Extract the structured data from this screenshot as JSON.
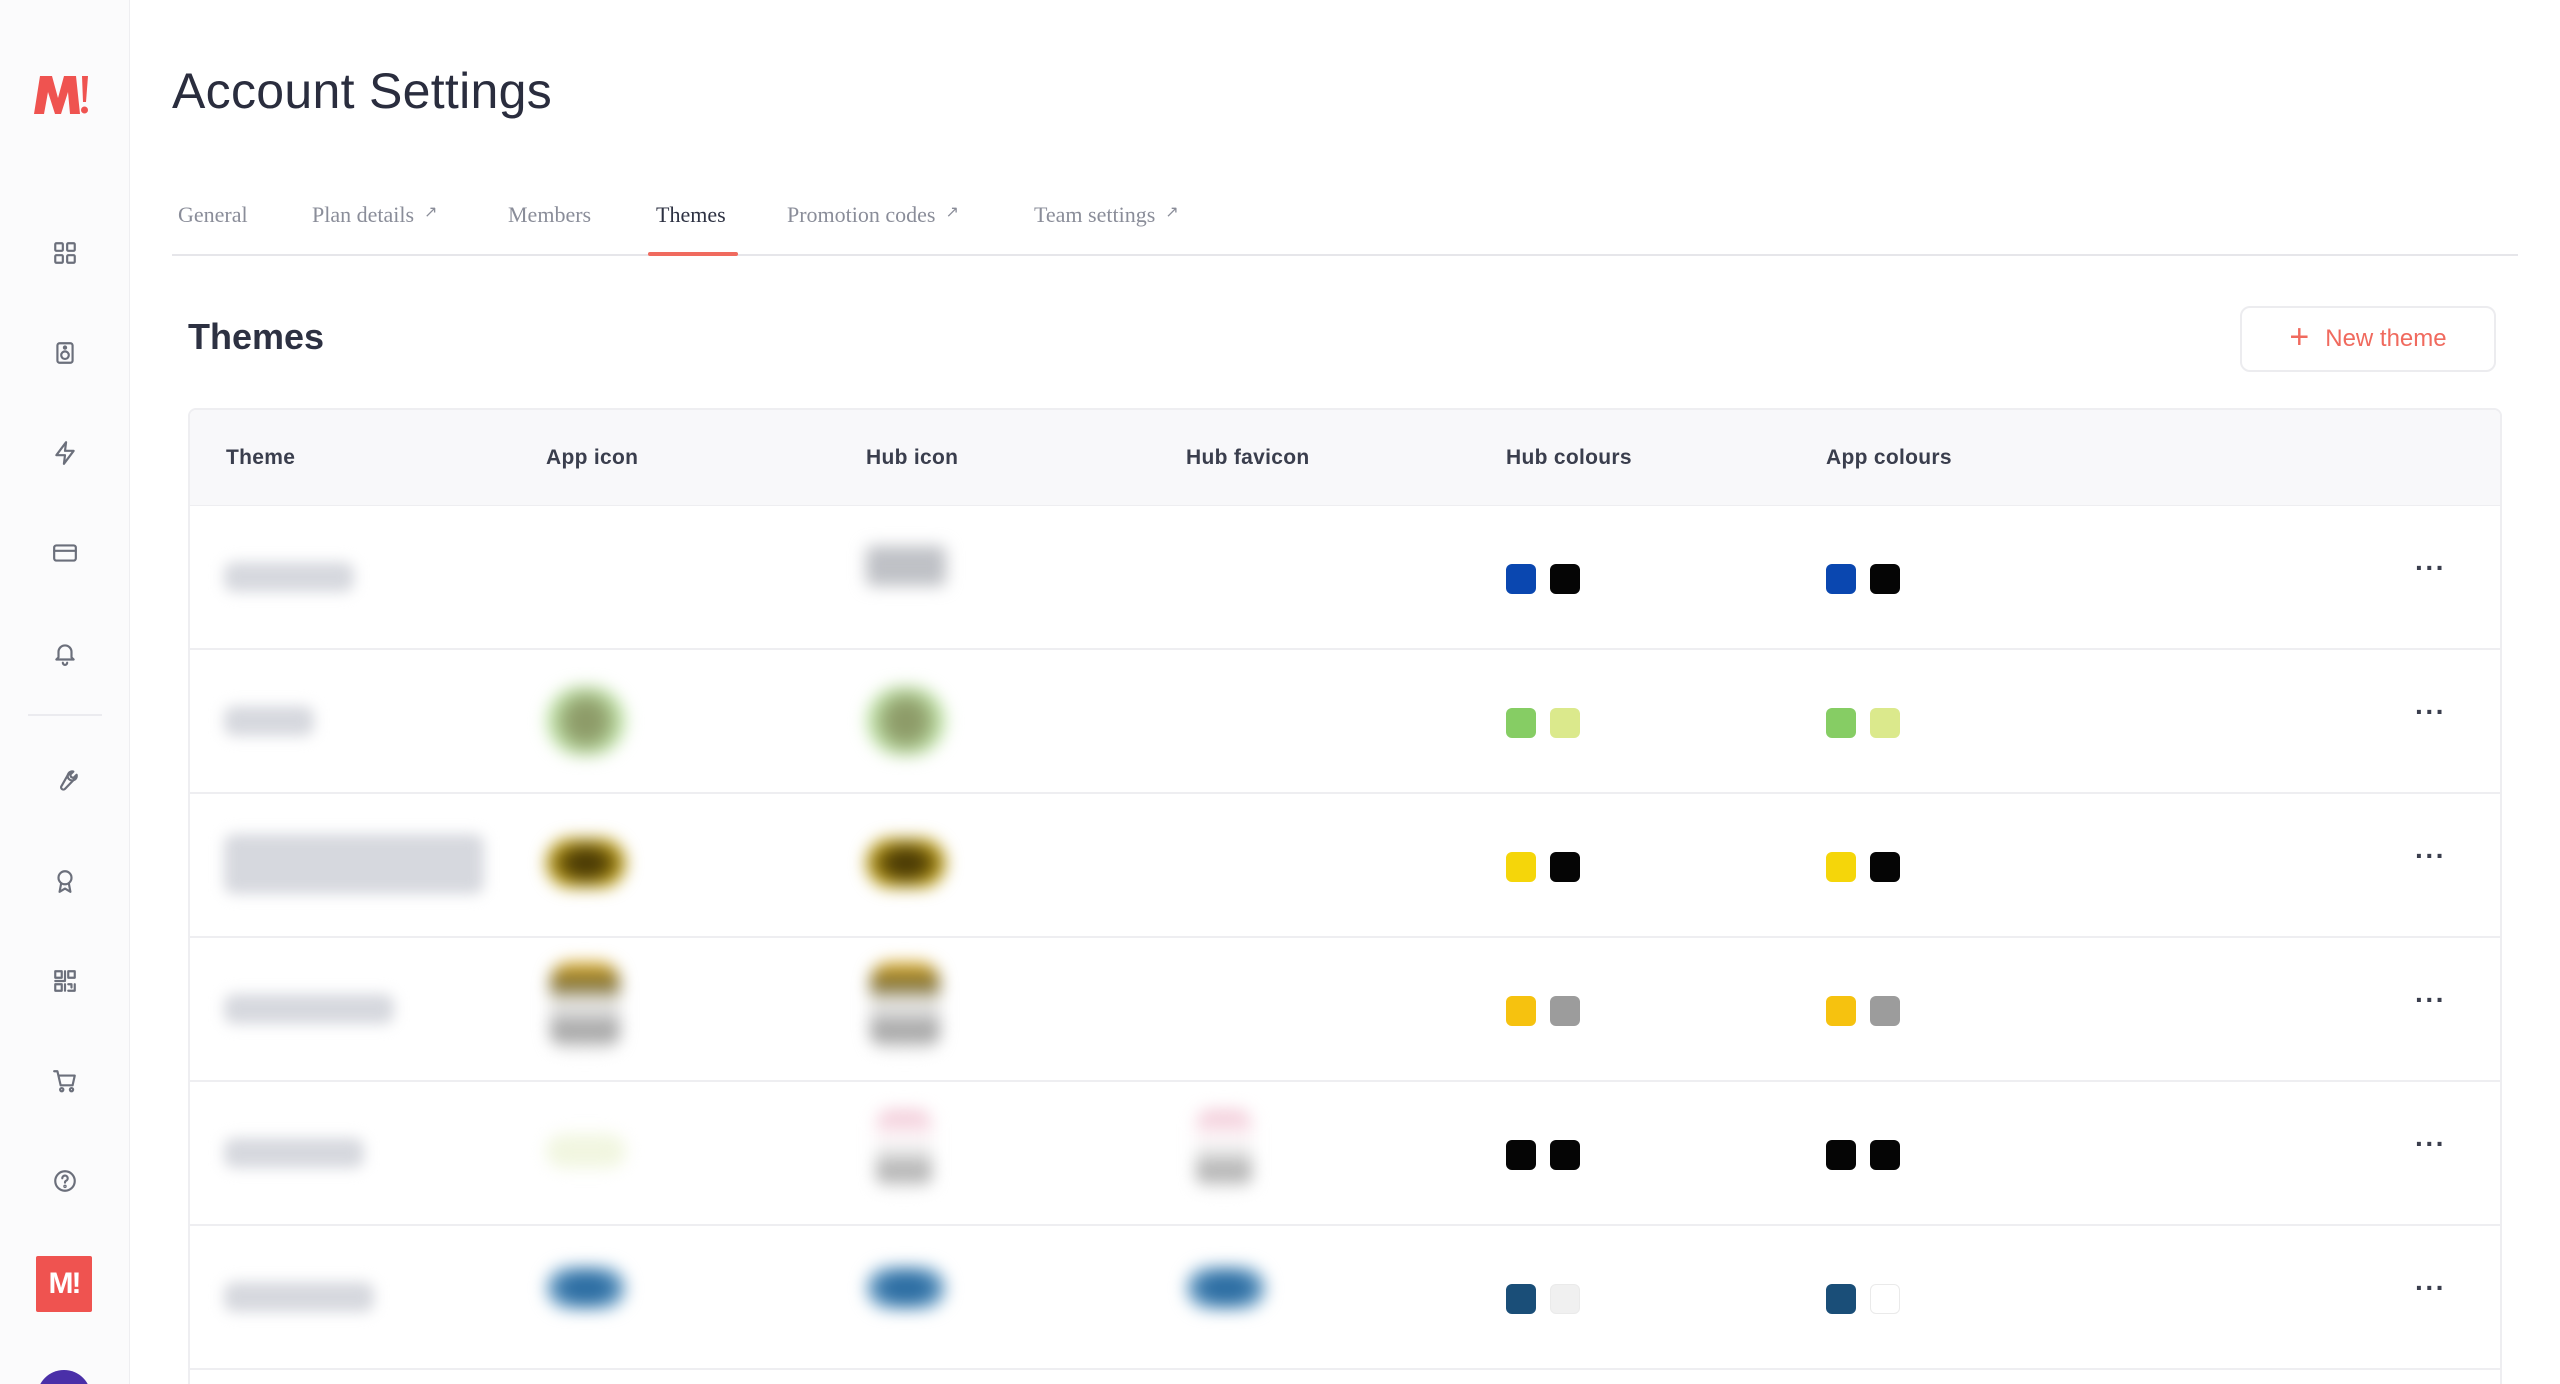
{
  "sidebar": {
    "logo_text": "M!",
    "icons": [
      "grid-icon",
      "speaker-icon",
      "lightning-icon",
      "card-icon",
      "bell-icon",
      "wrench-icon",
      "award-icon",
      "qr-code-icon",
      "cart-icon",
      "help-icon"
    ],
    "brand_badge": "M!"
  },
  "header": {
    "title": "Account Settings"
  },
  "tabs": [
    {
      "label": "General",
      "external": false
    },
    {
      "label": "Plan details",
      "external": true
    },
    {
      "label": "Members",
      "external": false
    },
    {
      "label": "Themes",
      "external": false,
      "active": true
    },
    {
      "label": "Promotion codes",
      "external": true
    },
    {
      "label": "Team settings",
      "external": true
    }
  ],
  "ext_glyph": "↗",
  "section": {
    "title": "Themes",
    "new_button": "New theme"
  },
  "table": {
    "columns": [
      "Theme",
      "App icon",
      "Hub icon",
      "Hub favicon",
      "Hub colours",
      "App colours"
    ],
    "rows": [
      {
        "hub_colours": [
          "#0a47b0",
          "#050505"
        ],
        "app_colours": [
          "#0a47b0",
          "#050505"
        ]
      },
      {
        "hub_colours": [
          "#86cd64",
          "#dbe98c"
        ],
        "app_colours": [
          "#86cd64",
          "#dbe98c"
        ]
      },
      {
        "hub_colours": [
          "#f5d60a",
          "#050505"
        ],
        "app_colours": [
          "#f5d60a",
          "#050505"
        ]
      },
      {
        "hub_colours": [
          "#f6c20f",
          "#9c9c9c"
        ],
        "app_colours": [
          "#f6c20f",
          "#9c9c9c"
        ]
      },
      {
        "hub_colours": [
          "#050505",
          "#050505"
        ],
        "app_colours": [
          "#050505",
          "#050505"
        ]
      },
      {
        "hub_colours": [
          "#1a4e78",
          "#f0f0f0"
        ],
        "app_colours": [
          "#1a4e78",
          "#ffffff"
        ]
      }
    ],
    "row_action": "···"
  },
  "colors": {
    "accent": "#f06a5e",
    "brand": "#ef5350"
  }
}
